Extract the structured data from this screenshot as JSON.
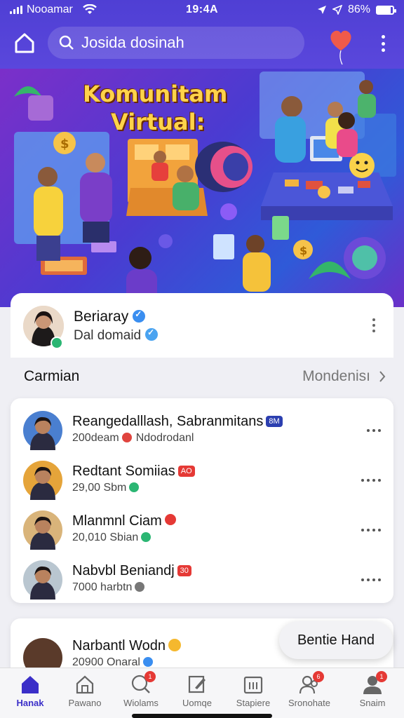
{
  "status_bar": {
    "carrier": "Nooamar",
    "time": "19:4A",
    "battery": "86%",
    "battery_level": 0.86
  },
  "header": {
    "search_text": "Josida dosinah",
    "icons": [
      "home-icon",
      "search-icon",
      "heart-balloon-icon",
      "more-vertical-icon"
    ]
  },
  "hero": {
    "title_line1": "Komunitam",
    "title_line2": "Virtual:"
  },
  "profile": {
    "name": "Beriaray",
    "subtitle": "Dal domaid"
  },
  "section": {
    "title": "Carmian",
    "link": "Mondenisı"
  },
  "list": [
    {
      "title": "Reangedalllash, Sabranmitans",
      "tag": "8M",
      "tag_color": "#2c3fb0",
      "sub": "200deam",
      "sub2": "Ndodrodanl",
      "avatar": "#4a7fd0"
    },
    {
      "title": "Redtant Somiias",
      "tag": "AO",
      "tag_color": "#e53935",
      "sub": "29,00 Sbm",
      "sub2": "",
      "avatar": "#e5a43a"
    },
    {
      "title": "Mlanmnl Ciam",
      "tag": "",
      "tag_color": "#e53935",
      "sub": "20,010 Sbian",
      "sub2": "",
      "avatar": "#d9b47a"
    },
    {
      "title": "Nabvbl Beniandj",
      "tag": "30",
      "tag_color": "#e53935",
      "sub": "7000 harbtn",
      "sub2": "",
      "avatar": "#b9c6d0"
    }
  ],
  "card2": {
    "title": "Narbantl Wodn",
    "sub": "20900 Onaral"
  },
  "float_button": "Bentie Hand",
  "tabs": [
    {
      "label": "Hanak",
      "icon": "home-icon",
      "badge": ""
    },
    {
      "label": "Pawano",
      "icon": "house-outline-icon",
      "badge": ""
    },
    {
      "label": "Wiolams",
      "icon": "search-chat-icon",
      "badge": "1"
    },
    {
      "label": "Uomqe",
      "icon": "edit-icon",
      "badge": ""
    },
    {
      "label": "Stapiere",
      "icon": "calendar-icon",
      "badge": ""
    },
    {
      "label": "Sronohate",
      "icon": "people-icon",
      "badge": "6"
    },
    {
      "label": "Snaim",
      "icon": "profile-icon",
      "badge": "1"
    }
  ]
}
